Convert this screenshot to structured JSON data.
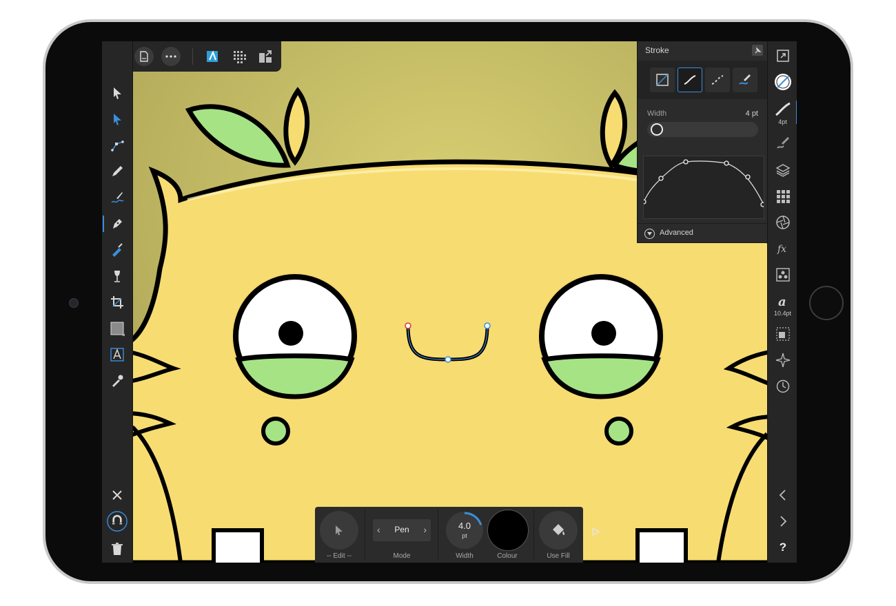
{
  "stroke_panel": {
    "title": "Stroke",
    "width_label": "Width",
    "width_value": "4 pt",
    "advanced_label": "Advanced"
  },
  "context_toolbar": {
    "edit_caption": "-- Edit --",
    "mode_value": "Pen",
    "mode_caption": "Mode",
    "width_number": "4.0",
    "width_unit": "pt",
    "width_caption": "Width",
    "colour_caption": "Colour",
    "use_fill_caption": "Use Fill"
  },
  "right_toolbar": {
    "stroke_width_label": "4pt",
    "text_size_label": "10.4pt",
    "help_label": "?"
  },
  "colors": {
    "accent": "#3a8fd9",
    "panel_bg": "#2b2b2b",
    "canvas_yellow": "#f7dc72",
    "eye_green": "#a8e886"
  }
}
